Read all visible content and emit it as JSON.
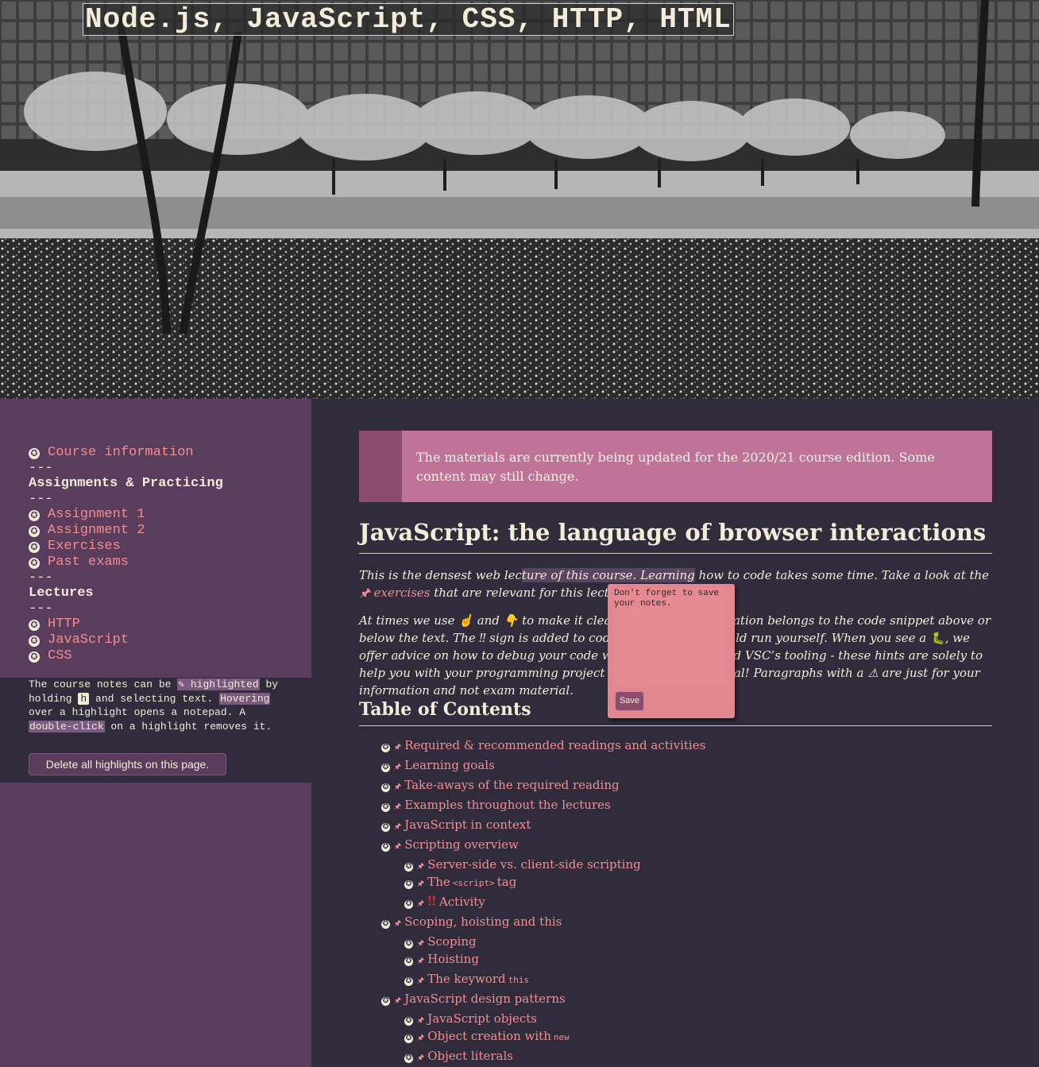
{
  "site": {
    "title": "Node.js, JavaScript, CSS, HTTP, HTML"
  },
  "sidebar": {
    "nav": [
      {
        "kind": "link",
        "label": "Course information"
      },
      {
        "kind": "separator",
        "label": "---"
      },
      {
        "kind": "heading",
        "label": "Assignments & Practicing"
      },
      {
        "kind": "separator",
        "label": "---"
      },
      {
        "kind": "link",
        "label": "Assignment 1"
      },
      {
        "kind": "link",
        "label": "Assignment 2"
      },
      {
        "kind": "link",
        "label": "Exercises"
      },
      {
        "kind": "link",
        "label": "Past exams"
      },
      {
        "kind": "separator",
        "label": "---"
      },
      {
        "kind": "heading",
        "label": "Lectures"
      },
      {
        "kind": "separator",
        "label": "---"
      },
      {
        "kind": "link",
        "label": "HTTP"
      },
      {
        "kind": "link",
        "label": "JavaScript"
      },
      {
        "kind": "link",
        "label": "CSS"
      }
    ],
    "help": {
      "t1": "The course notes can be ",
      "mark1": "✎ highlighted",
      "t2": " by holding ",
      "key": "h",
      "t3": " and selecting text. ",
      "mark2": "Hovering",
      "t4": " over a highlight opens a notepad. A ",
      "mark3": "double-click",
      "t5": " on a highlight removes it."
    },
    "delete_button": "Delete all highlights on this page."
  },
  "main": {
    "notice": "The materials are currently being updated for the 2020/21 course edition. Some content may still change.",
    "title": "JavaScript: the language of browser interactions",
    "intro1": {
      "a": "This is the densest web lec",
      "hl": "ture of this course. Learning",
      "b": " how to code takes some time. Take a look at the ",
      "link": "🖈 exercises",
      "c": " that are relevant for this lecture."
    },
    "intro2": {
      "a": "At times we use ☝ and 👇 to make it clear whether an explanation belongs to the code snippet above or below the text. The ‼ sign is added to code examples you should run yourself. When you see a 🐛, we offer advice on how to debug your code with the browser’s and VSC’s tooling - these hints are solely to help you with your programming project and not exam material! Paragraphs with a ⚠ are just for your information and not exam material."
    },
    "toc_title": "Table of Contents",
    "toc": [
      {
        "level": 0,
        "label": "Required & recommended readings and activities"
      },
      {
        "level": 0,
        "label": "Learning goals"
      },
      {
        "level": 0,
        "label": "Take-aways of the required reading"
      },
      {
        "level": 0,
        "label": "Examples throughout the lectures"
      },
      {
        "level": 0,
        "label": "JavaScript in context"
      },
      {
        "level": 0,
        "label": "Scripting overview"
      },
      {
        "level": 1,
        "label": "Server-side vs. client-side scripting"
      },
      {
        "level": 1,
        "label": "The",
        "code": "<script>",
        "after": "tag"
      },
      {
        "level": 1,
        "label": "Activity",
        "warn": "‼"
      },
      {
        "level": 0,
        "label": "Scoping, hoisting and this"
      },
      {
        "level": 1,
        "label": "Scoping"
      },
      {
        "level": 1,
        "label": "Hoisting"
      },
      {
        "level": 1,
        "label": "The keyword",
        "code": "this"
      },
      {
        "level": 0,
        "label": "JavaScript design patterns"
      },
      {
        "level": 1,
        "label": "JavaScript objects"
      },
      {
        "level": 1,
        "label": "Object creation with",
        "code": "new"
      },
      {
        "level": 1,
        "label": "Object literals"
      }
    ]
  },
  "note_popup": {
    "text": "Don't forget to save your notes.",
    "save_label": "Save"
  },
  "colors": {
    "sidebar": "#5a3d5c",
    "page": "#302c3c",
    "accent": "#f08f93",
    "notice": "#c07399"
  }
}
